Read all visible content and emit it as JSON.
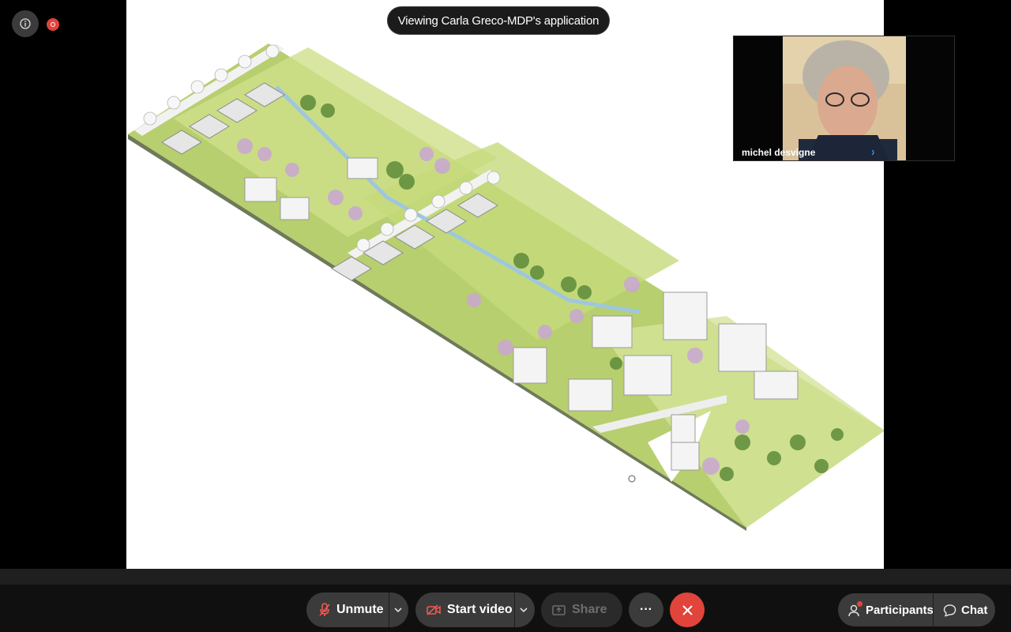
{
  "share": {
    "banner": "Viewing Carla Greco-MDP's application"
  },
  "participant_tile": {
    "name": "michel desvigne"
  },
  "toolbar": {
    "unmute_label": "Unmute",
    "start_video_label": "Start video",
    "share_label": "Share",
    "more_label": "···",
    "participants_label": "Participants",
    "chat_label": "Chat"
  },
  "colors": {
    "end_call": "#e0443b",
    "recording": "#e0443b",
    "muted_icon": "#ef5a52",
    "notification": "#e0443b"
  },
  "icons": {
    "info": "info-icon",
    "recording": "recording-icon",
    "mic": "microphone-muted-icon",
    "camera": "camera-off-icon",
    "share": "share-screen-icon",
    "more": "more-icon",
    "end": "close-icon",
    "participants": "participants-icon",
    "chat": "chat-bubble-icon"
  }
}
